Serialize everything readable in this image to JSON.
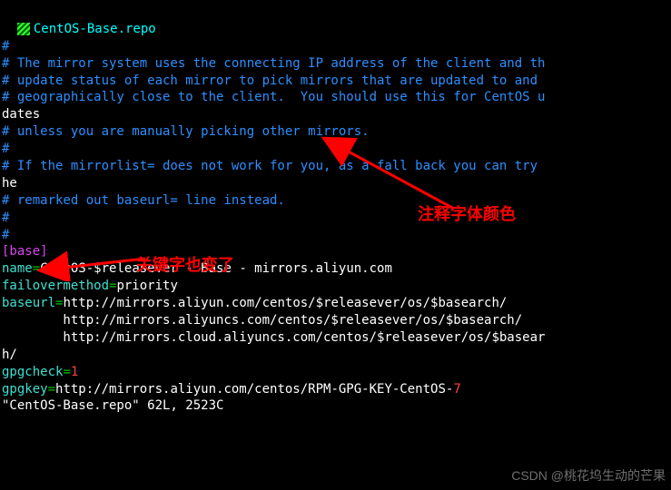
{
  "header": {
    "filename": "CentOS-Base.repo"
  },
  "comments": {
    "l1": "#",
    "l2": "# The mirror system uses the connecting IP address of the client and th",
    "l3": "# update status of each mirror to pick mirrors that are updated to and ",
    "l4": "# geographically close to the client.  You should use this for CentOS u",
    "l5": "dates",
    "l6": "# unless you are manually picking other mirrors.",
    "l7": "#",
    "l8": "# If the mirrorlist= does not work for you, as a fall back you can try ",
    "l9": "he",
    "l10": "# remarked out baseurl= line instead.",
    "l11": "#",
    "l12": "#"
  },
  "section": {
    "base": "[base]"
  },
  "config": {
    "name_key": "name",
    "name_prefix": "CentOS-",
    "name_var": "$releasever",
    "name_suffix": " - Base - mirrors.aliyun.com",
    "failover_key": "failovermethod",
    "failover_val": "priority",
    "baseurl_key": "baseurl",
    "url1": "http://mirrors.aliyun.com/centos/$releasever/os/$basearch/",
    "url2": "        http://mirrors.aliyuncs.com/centos/$releasever/os/$basearch/",
    "url3": "        http://mirrors.cloud.aliyuncs.com/centos/$releasever/os/$basear",
    "h_line": "h/",
    "gpgcheck_key": "gpgcheck",
    "gpgcheck_val": "1",
    "gpgkey_key": "gpgkey",
    "gpgkey_val": "http://mirrors.aliyun.com/centos/RPM-GPG-KEY-CentOS-",
    "gpgkey_num": "7"
  },
  "status": {
    "text": "\"CentOS-Base.repo\" 62L, 2523C"
  },
  "annotations": {
    "comment_color": "注释字体颜色",
    "keyword_changed": "关键字也变了"
  },
  "watermark": {
    "text": "CSDN @桃花坞生动的芒果"
  }
}
